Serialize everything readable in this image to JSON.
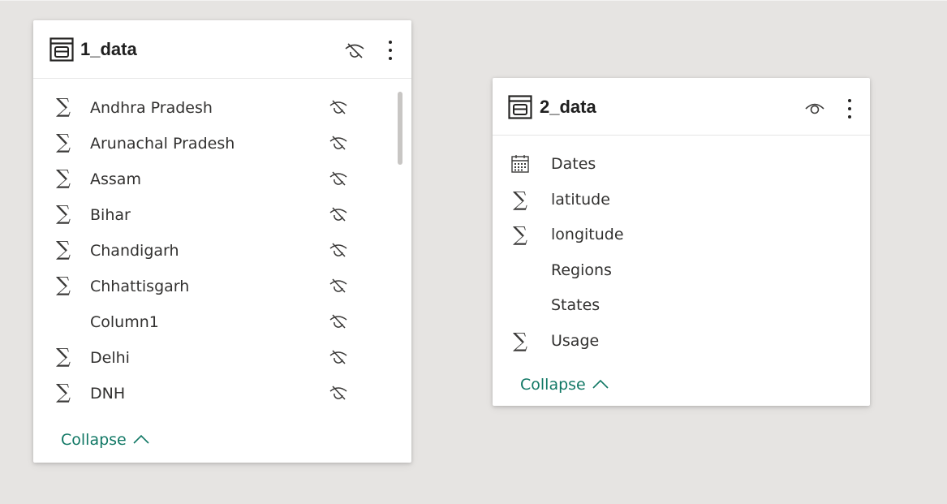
{
  "tables": [
    {
      "title": "1_data",
      "header_icon": "eye-hidden-icon",
      "fields": [
        {
          "label": "Andhra Pradesh",
          "icon": "sigma-icon",
          "hidden": true
        },
        {
          "label": "Arunachal Pradesh",
          "icon": "sigma-icon",
          "hidden": true
        },
        {
          "label": "Assam",
          "icon": "sigma-icon",
          "hidden": true
        },
        {
          "label": "Bihar",
          "icon": "sigma-icon",
          "hidden": true
        },
        {
          "label": "Chandigarh",
          "icon": "sigma-icon",
          "hidden": true
        },
        {
          "label": "Chhattisgarh",
          "icon": "sigma-icon",
          "hidden": true
        },
        {
          "label": "Column1",
          "icon": "none",
          "hidden": true
        },
        {
          "label": "Delhi",
          "icon": "sigma-icon",
          "hidden": true
        },
        {
          "label": "DNH",
          "icon": "sigma-icon",
          "hidden": true
        }
      ],
      "collapse_label": "Collapse"
    },
    {
      "title": "2_data",
      "header_icon": "eye-icon",
      "fields": [
        {
          "label": "Dates",
          "icon": "calendar-icon",
          "hidden": false
        },
        {
          "label": "latitude",
          "icon": "sigma-icon",
          "hidden": false
        },
        {
          "label": "longitude",
          "icon": "sigma-icon",
          "hidden": false
        },
        {
          "label": "Regions",
          "icon": "none",
          "hidden": false
        },
        {
          "label": "States",
          "icon": "none",
          "hidden": false
        },
        {
          "label": "Usage",
          "icon": "sigma-icon",
          "hidden": false
        }
      ],
      "collapse_label": "Collapse"
    }
  ],
  "colors": {
    "canvas_background": "#e6e4e2",
    "card_background": "#ffffff",
    "collapse_link": "#117865",
    "text": "#323130"
  }
}
